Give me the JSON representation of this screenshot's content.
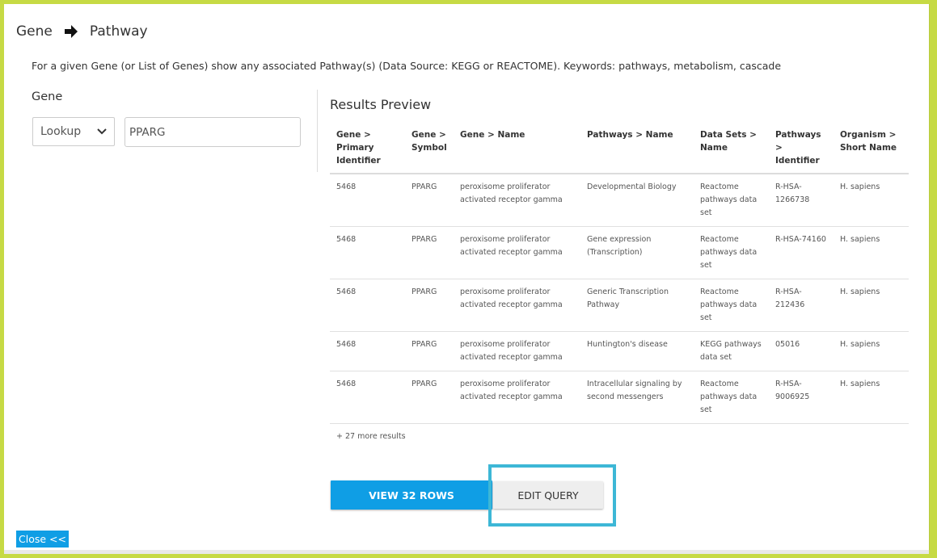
{
  "header": {
    "title_from": "Gene",
    "title_to": "Pathway",
    "arrow_icon": "arrow-right-icon"
  },
  "description": "For a given Gene (or List of Genes) show any associated Pathway(s) (Data Source: KEGG or REACTOME). Keywords: pathways, metabolism, cascade",
  "form": {
    "gene_label": "Gene",
    "lookup_value": "Lookup",
    "gene_value": "PPARG"
  },
  "results": {
    "title": "Results Preview",
    "columns": [
      "Gene > Primary Identifier",
      "Gene > Symbol",
      "Gene > Name",
      "Pathways > Name",
      "Data Sets > Name",
      "Pathways > Identifier",
      "Organism > Short Name"
    ],
    "rows": [
      [
        "5468",
        "PPARG",
        "peroxisome proliferator activated receptor gamma",
        "Developmental Biology",
        "Reactome pathways data set",
        "R-HSA-1266738",
        "H. sapiens"
      ],
      [
        "5468",
        "PPARG",
        "peroxisome proliferator activated receptor gamma",
        "Gene expression (Transcription)",
        "Reactome pathways data set",
        "R-HSA-74160",
        "H. sapiens"
      ],
      [
        "5468",
        "PPARG",
        "peroxisome proliferator activated receptor gamma",
        "Generic Transcription Pathway",
        "Reactome pathways data set",
        "R-HSA-212436",
        "H. sapiens"
      ],
      [
        "5468",
        "PPARG",
        "peroxisome proliferator activated receptor gamma",
        "Huntington's disease",
        "KEGG pathways data set",
        "05016",
        "H. sapiens"
      ],
      [
        "5468",
        "PPARG",
        "peroxisome proliferator activated receptor gamma",
        "Intracellular signaling by second messengers",
        "Reactome pathways data set",
        "R-HSA-9006925",
        "H. sapiens"
      ]
    ],
    "more_text": "+ 27 more results"
  },
  "actions": {
    "view_label": "VIEW 32 ROWS",
    "edit_label": "EDIT QUERY",
    "close_label": "Close <<"
  },
  "colors": {
    "frame": "#c6da44",
    "primary": "#0f9ee5",
    "highlight": "#3db7d6"
  }
}
